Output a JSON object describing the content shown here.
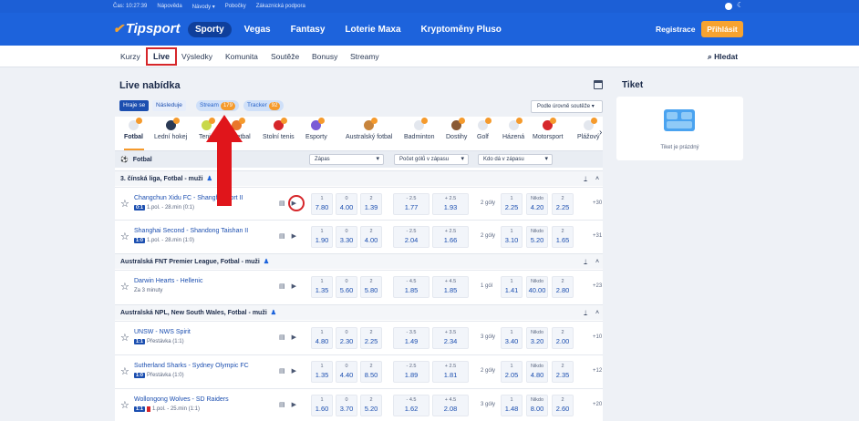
{
  "topbar": {
    "time": "Čas: 10:27:39",
    "links": [
      "Nápověda",
      "Návody ▾",
      "Pobočky",
      "Zákaznická podpora"
    ]
  },
  "brand": {
    "name": "Tipsport"
  },
  "mainnav": [
    "Sporty",
    "Vegas",
    "Fantasy",
    "Loterie Maxa",
    "Kryptoměny Pluso"
  ],
  "account": {
    "register": "Registrace",
    "login": "Přihlásit"
  },
  "subnav": {
    "items": [
      "Kurzy",
      "Live",
      "Výsledky",
      "Komunita",
      "Soutěže",
      "Bonusy",
      "Streamy"
    ],
    "search": "Hledat"
  },
  "page": {
    "title": "Live nabídka"
  },
  "ticket": {
    "title": "Tiket",
    "empty": "Tiket je prázdný"
  },
  "filters": {
    "playing": "Hraje se",
    "next": "Následuje",
    "stream": "Stream",
    "stream_count": "179",
    "tracker": "Tracker",
    "tracker_count": "92",
    "sort": "Podle úrovně soutěže ▾"
  },
  "sports": [
    "Fotbal",
    "Lední hokej",
    "Tenis",
    "Basketbal",
    "Stolní tenis",
    "Esporty",
    "Australský fotbal",
    "Badminton",
    "Dostihy",
    "Golf",
    "Házená",
    "Motorsport",
    "Plážový"
  ],
  "section": {
    "name": "Fotbal",
    "dd1": "Zápas",
    "dd2": "Počet gólů v zápasu",
    "dd3": "Kdo dá v zápasu"
  },
  "leagues": [
    {
      "name": "3. čínská liga, Fotbal - muži",
      "matches": [
        {
          "teams": "Changchun Xidu FC - Shanghai Port II",
          "score": "0:1",
          "status": "1.pol. - 28.min (0:1)",
          "odds": [
            "7.80",
            "4.00",
            "1.39"
          ],
          "tot": [
            "1.77",
            "1.93"
          ],
          "goal": "2 góly",
          "kd": [
            "2.25",
            "4.20",
            "2.25"
          ],
          "more": "+30"
        },
        {
          "teams": "Shanghai Second - Shandong Taishan II",
          "score": "1:0",
          "status": "1.pol. - 28.min (1:0)",
          "odds": [
            "1.90",
            "3.30",
            "4.00"
          ],
          "tot": [
            "2.04",
            "1.66"
          ],
          "goal": "2 góly",
          "kd": [
            "3.10",
            "5.20",
            "1.65"
          ],
          "more": "+31"
        }
      ]
    },
    {
      "name": "Australská FNT Premier League, Fotbal - muži",
      "matches": [
        {
          "teams": "Darwin Hearts - Hellenic",
          "score": "",
          "status": "Za 3 minuty",
          "odds": [
            "1.35",
            "5.60",
            "5.80"
          ],
          "tot": [
            "1.85",
            "1.85"
          ],
          "goal": "1 gól",
          "kd": [
            "1.41",
            "40.00",
            "2.80"
          ],
          "more": "+23"
        }
      ]
    },
    {
      "name": "Australská NPL, New South Wales, Fotbal - muži",
      "matches": [
        {
          "teams": "UNSW - NWS Spirit",
          "score": "1:1",
          "status": "Přestávka (1:1)",
          "odds": [
            "4.80",
            "2.30",
            "2.25"
          ],
          "tot": [
            "1.49",
            "2.34"
          ],
          "goal": "3 góly",
          "kd": [
            "3.40",
            "3.20",
            "2.00"
          ],
          "more": "+10"
        },
        {
          "teams": "Sutherland Sharks - Sydney Olympic FC",
          "score": "1:0",
          "status": "Přestávka (1:0)",
          "odds": [
            "1.35",
            "4.40",
            "8.50"
          ],
          "tot": [
            "1.89",
            "1.81"
          ],
          "goal": "2 góly",
          "kd": [
            "2.05",
            "4.80",
            "2.35"
          ],
          "more": "+12"
        },
        {
          "teams": "Wollongong Wolves - SD Raiders",
          "score": "1:1",
          "status": "1.pol. - 25.min (1:1)",
          "odds": [
            "1.60",
            "3.70",
            "5.20"
          ],
          "tot": [
            "1.62",
            "2.08"
          ],
          "goal": "3 góly",
          "kd": [
            "1.48",
            "8.00",
            "2.60"
          ],
          "more": "+20"
        }
      ]
    }
  ],
  "odds_headers": {
    "h": [
      "1",
      "0",
      "2"
    ],
    "tot": [
      "- 2.5",
      "+ 2.5"
    ],
    "kd": [
      "1",
      "Nikdo",
      "2"
    ]
  },
  "tot_variants": {
    "r3": [
      "- 4.5",
      "+ 4.5"
    ],
    "r4": [
      "- 3.5",
      "+ 3.5"
    ],
    "r5": [
      "- 2.5",
      "+ 2.5"
    ],
    "r6": [
      "- 4.5",
      "+ 4.5"
    ]
  },
  "colors": {
    "brand_blue": "#1d63dc",
    "accent": "#f59a2c",
    "highlight_red": "#d6262a"
  }
}
